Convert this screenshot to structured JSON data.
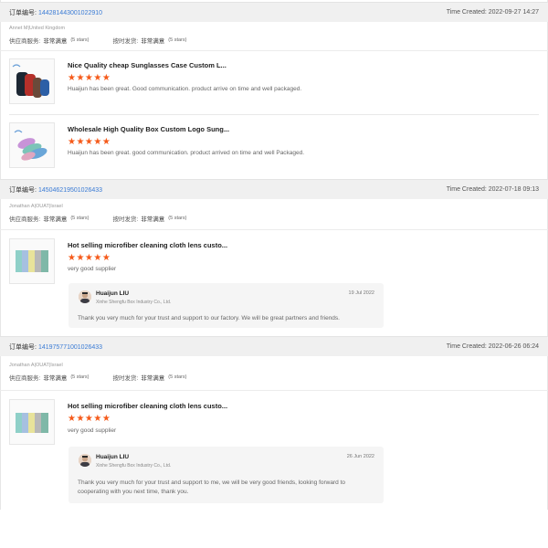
{
  "order_no_label": "订单编号:",
  "rating_supplier_label": "供应商服务:",
  "rating_delivery_label": "按时发货:",
  "orders": [
    {
      "order_no": "144281443001022910",
      "time_created": "Time Created: 2022-09-27 14:27",
      "buyer": "Annet M|United Kingdom",
      "supplier_rating": "非常满意",
      "supplier_stars": "(5 stars)",
      "delivery_rating": "非常满意",
      "delivery_stars": "(5 stars)",
      "products": [
        {
          "title": "Nice Quality cheap Sunglasses Case Custom L...",
          "stars": "★★★★★",
          "review": "Huaijun has been great. Good communication. product arrive on time and well packaged."
        },
        {
          "title": "Wholesale High Quality Box Custom Logo Sung...",
          "stars": "★★★★★",
          "review": "Huaijun has been great. good communication. product arrived on time and well Packaged."
        }
      ]
    },
    {
      "order_no": "145046219501026433",
      "time_created": "Time Created: 2022-07-18 09:13",
      "buyer": "Jonathan A|OUAT|Israel",
      "supplier_rating": "非常满意",
      "supplier_stars": "(5 stars)",
      "delivery_rating": "非常满意",
      "delivery_stars": "(5 stars)",
      "products": [
        {
          "title": "Hot selling microfiber cleaning cloth lens custo...",
          "stars": "★★★★★",
          "review": "very good supplier"
        }
      ],
      "reply": {
        "name": "Huaijun LIU",
        "company": "Xinhe Shengfu Box Industry Co., Ltd.",
        "date": "19 Jul 2022",
        "message_lines": [
          "Thank you very much for your trust and support to our factory. We will be great partners and friends."
        ]
      }
    },
    {
      "order_no": "141975771001026433",
      "time_created": "Time Created: 2022-06-26 06:24",
      "buyer": "Jonathan A|OUAT|Israel",
      "supplier_rating": "非常满意",
      "supplier_stars": "(5 stars)",
      "delivery_rating": "非常满意",
      "delivery_stars": "(5 stars)",
      "products": [
        {
          "title": "Hot selling microfiber cleaning cloth lens custo...",
          "stars": "★★★★★",
          "review": "very good supplier"
        }
      ],
      "reply": {
        "name": "Huaijun LIU",
        "company": "Xinhe Shengfu Box Industry Co., Ltd.",
        "date": "26 Jun 2022",
        "message_lines": [
          "Thank you very much for your trust and support to me, we will be very good friends, looking forward to",
          "cooperating with you next time, thank you."
        ]
      }
    }
  ],
  "colors": {
    "link": "#3a7bd5",
    "star": "#f55a1a",
    "header_bg": "#f0f0f0",
    "reply_bg": "#f5f5f5"
  },
  "icons": {
    "avatar": "avatar-icon",
    "thumbnail": "product-thumbnail-icon"
  }
}
